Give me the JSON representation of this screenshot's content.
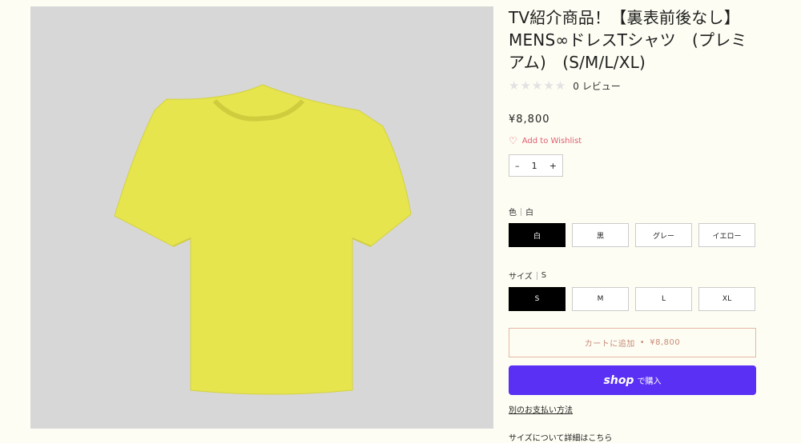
{
  "product": {
    "title": "TV紹介商品！【裏表前後なし】MENS∞ドレスTシャツ　(プレミアム)　(S/M/L/XL)",
    "stars": "★★★★★",
    "review_count": "0 レビュー",
    "price": "¥8,800",
    "wishlist_label": "Add to Wishlist",
    "quantity": "1",
    "qty_minus": "–",
    "qty_plus": "+"
  },
  "color_option": {
    "label": "色",
    "selected": "白",
    "values": [
      "白",
      "黒",
      "グレー",
      "イエロー"
    ]
  },
  "size_option": {
    "label": "サイズ",
    "selected": "S",
    "values": [
      "S",
      "M",
      "L",
      "XL"
    ]
  },
  "cart": {
    "label": "カートに追加",
    "dot": "•",
    "price": "¥8,800"
  },
  "shop_pay": {
    "logo": "shop",
    "label": "で購入",
    "color": "#5a31f4"
  },
  "links": {
    "alt_payment": "別のお支払い方法",
    "size_detail": "サイズについて詳細はこちら"
  },
  "image": {
    "garment_color": "#e7e54e",
    "background_color": "#d7d7d7"
  }
}
